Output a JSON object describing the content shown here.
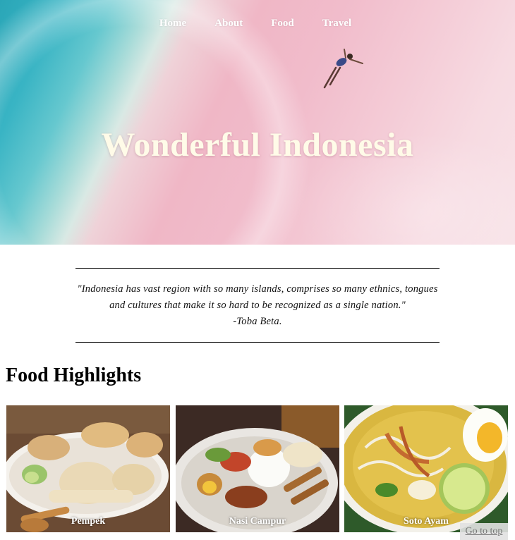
{
  "nav": {
    "items": [
      {
        "label": "Home"
      },
      {
        "label": "About"
      },
      {
        "label": "Food"
      },
      {
        "label": "Travel"
      }
    ]
  },
  "hero": {
    "title": "Wonderful Indonesia"
  },
  "quote": {
    "text": "\"Indonesia has vast region with so many islands, comprises so many ethnics, tongues and cultures that make it so hard to be recognized as a single nation.\"",
    "author": "-Toba Beta."
  },
  "food": {
    "title": "Food Highlights",
    "items": [
      {
        "caption": "Pempek"
      },
      {
        "caption": "Nasi Campur"
      },
      {
        "caption": "Soto Ayam"
      }
    ]
  },
  "go_to_top": "Go to top",
  "colors": {
    "hero_title": "#fffbe8",
    "nav_text": "#ffffff",
    "sea": "#2aa6b7",
    "pink_sand": "#f1bccb"
  }
}
